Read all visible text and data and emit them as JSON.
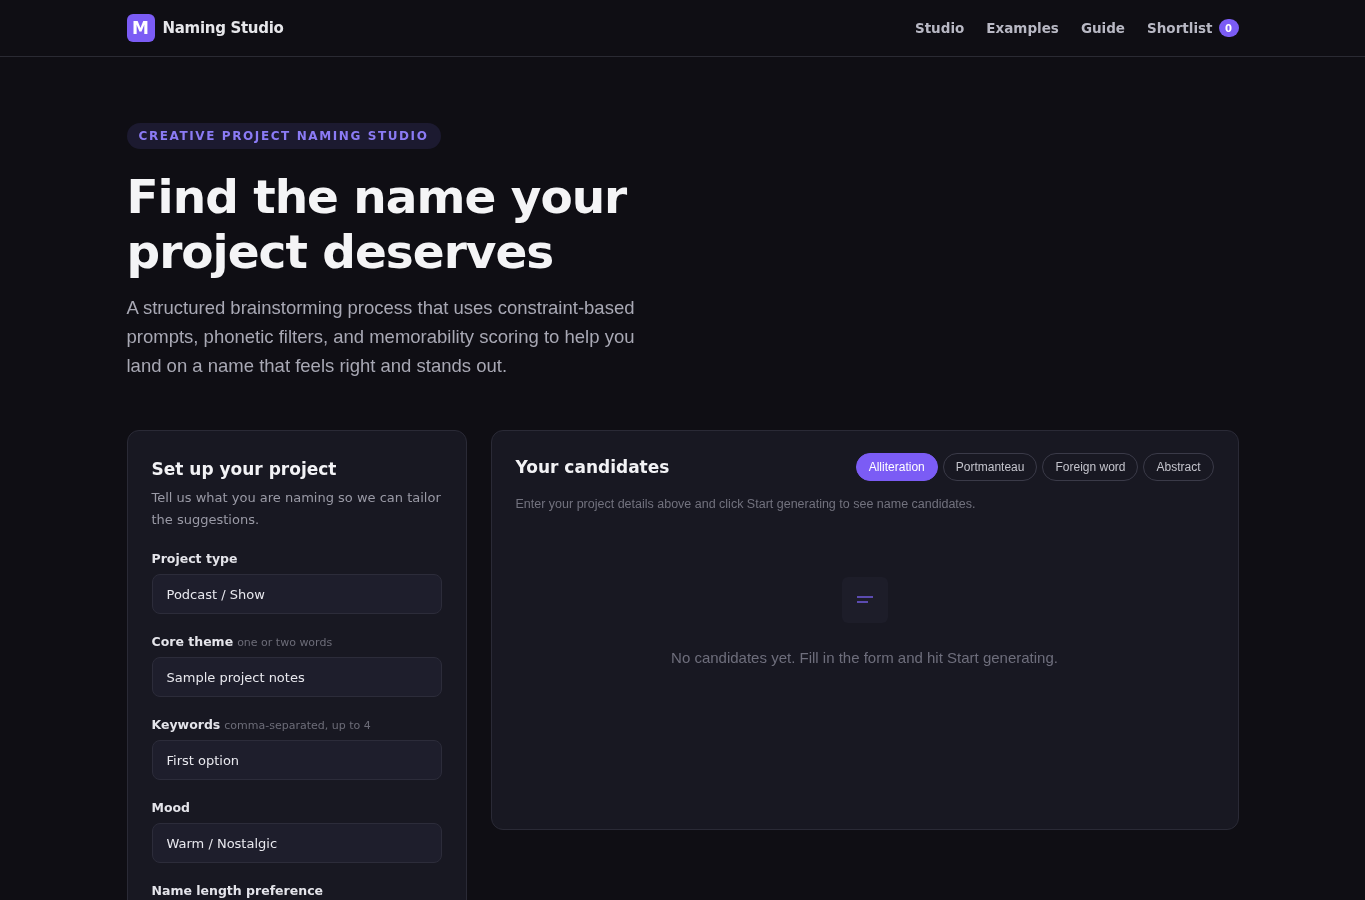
{
  "header": {
    "logo_letter": "M",
    "brand": "Naming Studio",
    "nav": [
      {
        "label": "Studio"
      },
      {
        "label": "Examples"
      },
      {
        "label": "Guide"
      },
      {
        "label": "Shortlist",
        "badge": "0"
      }
    ]
  },
  "hero": {
    "eyebrow": "CREATIVE PROJECT NAMING STUDIO",
    "title": "Find the name your project deserves",
    "intro": "A structured brainstorming process that uses constraint-based prompts, phonetic filters, and memorability scoring to help you land on a name that feels right and stands out."
  },
  "setup": {
    "title": "Set up your project",
    "subtitle": "Tell us what you are naming so we can tailor the suggestions.",
    "fields": [
      {
        "label": "Project type",
        "value": "Podcast / Show"
      },
      {
        "label": "Core theme",
        "hint": "one or two words",
        "value": "Sample project notes"
      },
      {
        "label": "Keywords",
        "hint": "comma-separated, up to 4",
        "value": "First option"
      },
      {
        "label": "Mood",
        "value": "Warm / Nostalgic"
      },
      {
        "label": "Name length preference"
      }
    ]
  },
  "candidates": {
    "title": "Your candidates",
    "styles": [
      {
        "label": "Alliteration",
        "selected": true
      },
      {
        "label": "Portmanteau",
        "selected": false
      },
      {
        "label": "Foreign word",
        "selected": false
      },
      {
        "label": "Abstract",
        "selected": false
      }
    ],
    "instructions": "Enter your project details above and click Start generating to see name candidates.",
    "empty_message": "No candidates yet. Fill in the form and hit Start generating."
  }
}
